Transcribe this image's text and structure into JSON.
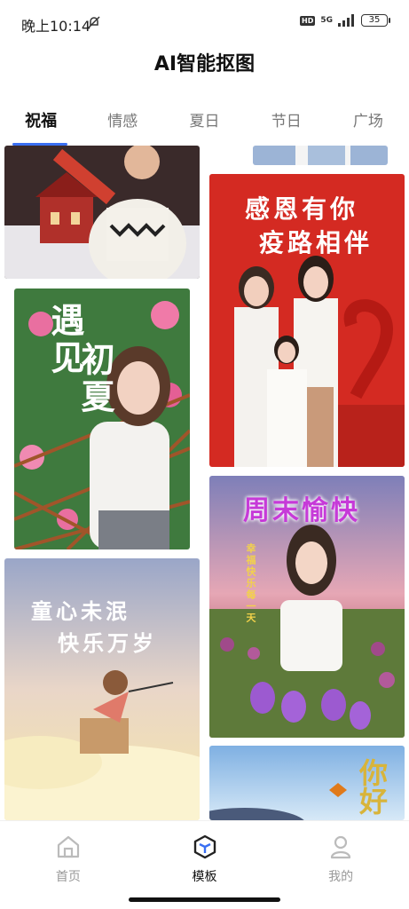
{
  "status_bar": {
    "time": "晚上10:14",
    "hd": "HD",
    "network": "5G",
    "battery": "35"
  },
  "app": {
    "title": "AI智能抠图"
  },
  "tabs": [
    {
      "label": "祝福",
      "active": true
    },
    {
      "label": "情感",
      "active": false
    },
    {
      "label": "夏日",
      "active": false
    },
    {
      "label": "节日",
      "active": false
    },
    {
      "label": "广场",
      "active": false
    }
  ],
  "cards": {
    "gratitude": {
      "line1": "感恩有你",
      "line2": "疫路相伴"
    },
    "summer": {
      "line1": "遇见",
      "line2": "初夏"
    },
    "weekend": {
      "title": "周末愉快",
      "side": "幸福快乐每一天"
    },
    "childhood": {
      "line1": "童心未泯",
      "line2": "快乐万岁"
    },
    "hello": {
      "text": "你好"
    }
  },
  "bottom_nav": [
    {
      "label": "首页",
      "icon": "home-icon",
      "active": false
    },
    {
      "label": "模板",
      "icon": "template-cube-icon",
      "active": true
    },
    {
      "label": "我的",
      "icon": "profile-icon",
      "active": false
    }
  ],
  "colors": {
    "accent": "#3a6ff2",
    "inactive": "#999999"
  }
}
